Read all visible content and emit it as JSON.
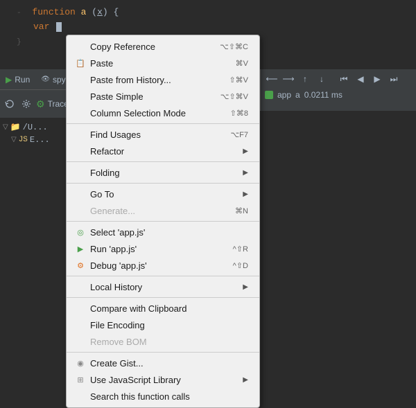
{
  "editor": {
    "line1": "function a(x) {",
    "line2": "  var",
    "line3": "}"
  },
  "topPanel": {
    "runTab": "Run",
    "spyTab": "spy"
  },
  "tracePanel": {
    "label": "Trace"
  },
  "rightPanel": {
    "appLabel": "app",
    "fnLabel": "a",
    "timing": "0.0211 ms"
  },
  "contextMenu": {
    "items": [
      {
        "id": "copy-reference",
        "label": "Copy Reference",
        "shortcut": "⌥⇧⌘C",
        "icon": "",
        "hasArrow": false,
        "disabled": false
      },
      {
        "id": "paste",
        "label": "Paste",
        "shortcut": "⌘V",
        "icon": "paste",
        "hasArrow": false,
        "disabled": false
      },
      {
        "id": "paste-from-history",
        "label": "Paste from History...",
        "shortcut": "⇧⌘V",
        "icon": "",
        "hasArrow": false,
        "disabled": false
      },
      {
        "id": "paste-simple",
        "label": "Paste Simple",
        "shortcut": "⌥⇧⌘V",
        "icon": "",
        "hasArrow": false,
        "disabled": false
      },
      {
        "id": "column-selection-mode",
        "label": "Column Selection Mode",
        "shortcut": "⇧⌘8",
        "icon": "",
        "hasArrow": false,
        "disabled": false
      },
      {
        "separator": true
      },
      {
        "id": "find-usages",
        "label": "Find Usages",
        "shortcut": "⌥F7",
        "icon": "",
        "hasArrow": false,
        "disabled": false
      },
      {
        "id": "refactor",
        "label": "Refactor",
        "shortcut": "",
        "icon": "",
        "hasArrow": true,
        "disabled": false
      },
      {
        "separator": true
      },
      {
        "id": "folding",
        "label": "Folding",
        "shortcut": "",
        "icon": "",
        "hasArrow": true,
        "disabled": false
      },
      {
        "separator": true
      },
      {
        "id": "goto",
        "label": "Go To",
        "shortcut": "",
        "icon": "",
        "hasArrow": true,
        "disabled": false
      },
      {
        "id": "generate",
        "label": "Generate...",
        "shortcut": "⌘N",
        "icon": "",
        "hasArrow": false,
        "disabled": true
      },
      {
        "separator": true
      },
      {
        "id": "select-appjs",
        "label": "Select 'app.js'",
        "shortcut": "",
        "icon": "select",
        "hasArrow": false,
        "disabled": false
      },
      {
        "id": "run-appjs",
        "label": "Run 'app.js'",
        "shortcut": "^⇧R",
        "icon": "run",
        "hasArrow": false,
        "disabled": false
      },
      {
        "id": "debug-appjs",
        "label": "Debug 'app.js'",
        "shortcut": "^⇧D",
        "icon": "debug",
        "hasArrow": false,
        "disabled": false
      },
      {
        "separator": true
      },
      {
        "id": "local-history",
        "label": "Local History",
        "shortcut": "",
        "icon": "",
        "hasArrow": true,
        "disabled": false
      },
      {
        "separator": true
      },
      {
        "id": "compare-clipboard",
        "label": "Compare with Clipboard",
        "shortcut": "",
        "icon": "",
        "hasArrow": false,
        "disabled": false
      },
      {
        "id": "file-encoding",
        "label": "File Encoding",
        "shortcut": "",
        "icon": "",
        "hasArrow": false,
        "disabled": false
      },
      {
        "id": "remove-bom",
        "label": "Remove BOM",
        "shortcut": "",
        "icon": "",
        "hasArrow": false,
        "disabled": true
      },
      {
        "separator": true
      },
      {
        "id": "create-gist",
        "label": "Create Gist...",
        "shortcut": "",
        "icon": "gist",
        "hasArrow": false,
        "disabled": false
      },
      {
        "id": "use-js-library",
        "label": "Use JavaScript Library",
        "shortcut": "",
        "icon": "library",
        "hasArrow": true,
        "disabled": false
      },
      {
        "id": "search-function-calls",
        "label": "Search this function calls",
        "shortcut": "",
        "icon": "",
        "hasArrow": false,
        "disabled": false
      }
    ]
  }
}
